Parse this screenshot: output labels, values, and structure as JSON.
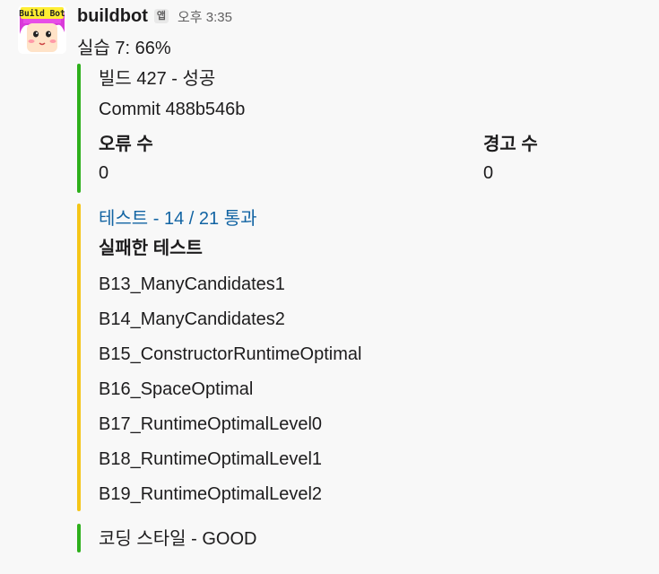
{
  "message": {
    "username": "buildbot",
    "app_badge": "앱",
    "timestamp": "오후 3:35",
    "text": "실습 7: 66%",
    "avatar_label": "Build Bot"
  },
  "attachments": {
    "build": {
      "color": "#2eb01c",
      "title": "빌드 427 - 성공",
      "commit": "Commit 488b546b",
      "fields": [
        {
          "title": "오류 수",
          "value": "0"
        },
        {
          "title": "경고 수",
          "value": "0"
        }
      ]
    },
    "tests": {
      "color": "#f5c518",
      "title": "테스트 - 14 / 21 통과",
      "subtitle": "실패한 테스트",
      "failed": [
        "B13_ManyCandidates1",
        "B14_ManyCandidates2",
        "B15_ConstructorRuntimeOptimal",
        "B16_SpaceOptimal",
        "B17_RuntimeOptimalLevel0",
        "B18_RuntimeOptimalLevel1",
        "B19_RuntimeOptimalLevel2"
      ]
    },
    "style": {
      "color": "#2eb01c",
      "text": "코딩 스타일 - GOOD"
    }
  }
}
